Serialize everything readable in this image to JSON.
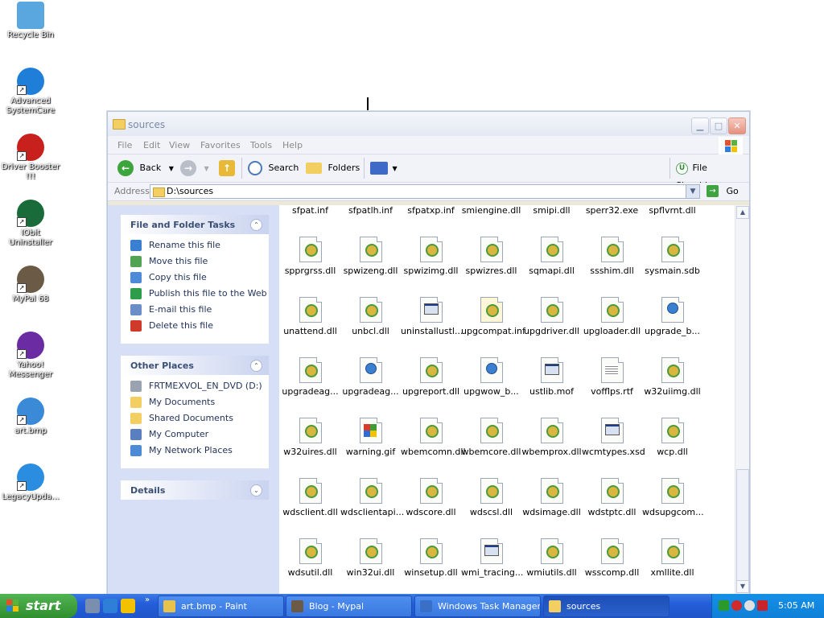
{
  "desktop": {
    "icons": [
      {
        "label": "Recycle Bin",
        "icon": "recycle-bin-icon",
        "color": "#5aa7e0"
      },
      {
        "label": "Advanced SystemCare",
        "icon": "advanced-systemcare-icon",
        "color": "#1f7fd8"
      },
      {
        "label": "Driver Booster !!!",
        "icon": "driver-booster-icon",
        "color": "#c8201c"
      },
      {
        "label": "IObit Uninstaller",
        "icon": "iobit-uninstaller-icon",
        "color": "#1a6b3a"
      },
      {
        "label": "MyPal 68",
        "icon": "mypal-icon",
        "color": "#6b5a45"
      },
      {
        "label": "Yahoo! Messenger",
        "icon": "yahoo-messenger-icon",
        "color": "#6a2ba3"
      },
      {
        "label": "art.bmp",
        "icon": "bitmap-file-icon",
        "color": "#3a8ad8"
      },
      {
        "label": "LegacyUpda...",
        "icon": "legacy-update-icon",
        "color": "#2b8de0"
      }
    ]
  },
  "window": {
    "title": "sources",
    "menu": [
      "File",
      "Edit",
      "View",
      "Favorites",
      "Tools",
      "Help"
    ],
    "toolbar": {
      "back_label": "Back",
      "search_label": "Search",
      "folders_label": "Folders",
      "file_shredder_label": "File Shredder"
    },
    "address": {
      "label": "Address",
      "value": "D:\\sources",
      "go_label": "Go"
    }
  },
  "tasks": {
    "file_folder": {
      "title": "File and Folder Tasks",
      "items": [
        {
          "label": "Rename this file",
          "icon": "rename-icon"
        },
        {
          "label": "Move this file",
          "icon": "move-icon"
        },
        {
          "label": "Copy this file",
          "icon": "copy-icon"
        },
        {
          "label": "Publish this file to the Web",
          "icon": "publish-web-icon"
        },
        {
          "label": "E-mail this file",
          "icon": "email-icon"
        },
        {
          "label": "Delete this file",
          "icon": "delete-icon"
        }
      ]
    },
    "other_places": {
      "title": "Other Places",
      "items": [
        {
          "label": "FRTMEXVOL_EN_DVD (D:)",
          "icon": "dvd-drive-icon"
        },
        {
          "label": "My Documents",
          "icon": "my-documents-icon"
        },
        {
          "label": "Shared Documents",
          "icon": "shared-documents-icon"
        },
        {
          "label": "My Computer",
          "icon": "my-computer-icon"
        },
        {
          "label": "My Network Places",
          "icon": "network-places-icon"
        }
      ]
    },
    "details": {
      "title": "Details"
    }
  },
  "files": {
    "partial_row": [
      "sfpat.inf",
      "sfpatlh.inf",
      "sfpatxp.inf",
      "smiengine.dll",
      "smipi.dll",
      "sperr32.exe",
      "spflvrnt.dll"
    ],
    "rows": [
      [
        {
          "name": "spprgrss.dll",
          "type": "dll"
        },
        {
          "name": "spwizeng.dll",
          "type": "dll"
        },
        {
          "name": "spwizimg.dll",
          "type": "dll"
        },
        {
          "name": "spwizres.dll",
          "type": "dll"
        },
        {
          "name": "sqmapi.dll",
          "type": "dll"
        },
        {
          "name": "ssshim.dll",
          "type": "dll"
        },
        {
          "name": "sysmain.sdb",
          "type": "dll"
        }
      ],
      [
        {
          "name": "unattend.dll",
          "type": "dll"
        },
        {
          "name": "unbcl.dll",
          "type": "dll"
        },
        {
          "name": "uninstallustl...",
          "type": "window"
        },
        {
          "name": "upgcompat.inf",
          "type": "inf"
        },
        {
          "name": "upgdriver.dll",
          "type": "dll"
        },
        {
          "name": "upgloader.dll",
          "type": "dll"
        },
        {
          "name": "upgrade_b...",
          "type": "web"
        }
      ],
      [
        {
          "name": "upgradeag...",
          "type": "dll"
        },
        {
          "name": "upgradeag...",
          "type": "web"
        },
        {
          "name": "upgreport.dll",
          "type": "dll"
        },
        {
          "name": "upgwow_b...",
          "type": "web"
        },
        {
          "name": "ustlib.mof",
          "type": "window"
        },
        {
          "name": "vofflps.rtf",
          "type": "text"
        },
        {
          "name": "w32uiimg.dll",
          "type": "dll"
        }
      ],
      [
        {
          "name": "w32uires.dll",
          "type": "dll"
        },
        {
          "name": "warning.gif",
          "type": "gif"
        },
        {
          "name": "wbemcomn.dll",
          "type": "dll"
        },
        {
          "name": "wbemcore.dll",
          "type": "dll"
        },
        {
          "name": "wbemprox.dll",
          "type": "dll"
        },
        {
          "name": "wcmtypes.xsd",
          "type": "window"
        },
        {
          "name": "wcp.dll",
          "type": "dll"
        }
      ],
      [
        {
          "name": "wdsclient.dll",
          "type": "dll"
        },
        {
          "name": "wdsclientapi...",
          "type": "dll"
        },
        {
          "name": "wdscore.dll",
          "type": "dll"
        },
        {
          "name": "wdscsl.dll",
          "type": "dll"
        },
        {
          "name": "wdsimage.dll",
          "type": "dll"
        },
        {
          "name": "wdstptc.dll",
          "type": "dll"
        },
        {
          "name": "wdsupgcom...",
          "type": "dll"
        }
      ],
      [
        {
          "name": "wdsutil.dll",
          "type": "dll"
        },
        {
          "name": "win32ui.dll",
          "type": "dll"
        },
        {
          "name": "winsetup.dll",
          "type": "dll"
        },
        {
          "name": "wmi_tracing...",
          "type": "window"
        },
        {
          "name": "wmiutils.dll",
          "type": "dll"
        },
        {
          "name": "wsscomp.dll",
          "type": "dll"
        },
        {
          "name": "xmllite.dll",
          "type": "dll"
        }
      ]
    ]
  },
  "taskbar": {
    "start_label": "start",
    "quick_launch": [
      "show-desktop-icon",
      "ie-icon",
      "messenger-icon"
    ],
    "tasks": [
      {
        "label": "art.bmp - Paint",
        "icon": "paint-icon",
        "active": false
      },
      {
        "label": "Blog - Mypal",
        "icon": "mypal-icon",
        "active": false
      },
      {
        "label": "Windows Task Manager",
        "icon": "task-manager-icon",
        "active": false
      },
      {
        "label": "sources",
        "icon": "folder-icon",
        "active": true
      }
    ],
    "clock": "5:05 AM"
  }
}
